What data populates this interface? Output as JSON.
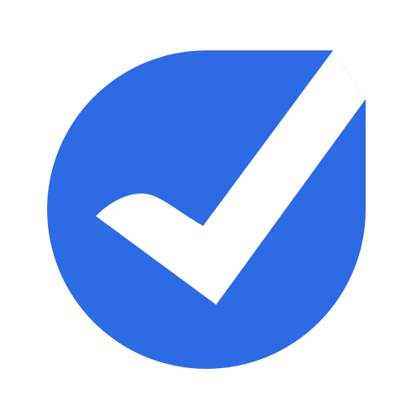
{
  "logo": {
    "icon": "checkmark-badge-icon",
    "colors": {
      "badge": "#2d6be4",
      "check": "#ffffff",
      "background": "#ffffff"
    }
  }
}
